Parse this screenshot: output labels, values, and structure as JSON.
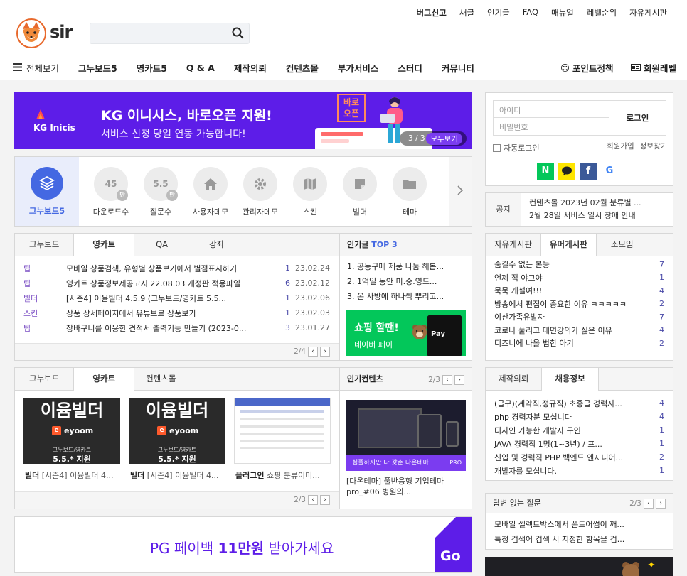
{
  "header": {
    "logo_text": "sir",
    "search_placeholder": "",
    "util_links": [
      "버그신고",
      "새글",
      "인기글",
      "FAQ",
      "매뉴얼",
      "레벨순위",
      "자유게시판"
    ],
    "gnb_all": "전체보기",
    "gnb_items": [
      "그누보드5",
      "영카트5",
      "Q & A",
      "제작의뢰",
      "컨텐츠몰",
      "부가서비스",
      "스터디",
      "커뮤니티"
    ],
    "point_policy": "포인트정책",
    "member_level": "회원레벨"
  },
  "banner": {
    "brand": "KG Inicis",
    "headline": "KG 이니시스, 바로오픈 지원!",
    "subline": "서비스 신청 당일 연동 가능합니다!",
    "badge": "바로\n오픈",
    "badge_line1": "바로",
    "badge_line2": "오픈",
    "pager": "3 / 3",
    "view_all": "모두보기"
  },
  "quick": {
    "title": "그누보드5",
    "items": [
      {
        "label": "다운로드수",
        "value": "45",
        "badge": "만"
      },
      {
        "label": "질문수",
        "value": "5.5",
        "badge": "만"
      },
      {
        "label": "사용자데모",
        "icon": "home-icon"
      },
      {
        "label": "관리자데모",
        "icon": "gear-icon"
      },
      {
        "label": "스킨",
        "icon": "map-icon"
      },
      {
        "label": "빌더",
        "icon": "note-icon"
      },
      {
        "label": "테마",
        "icon": "folder-icon"
      }
    ]
  },
  "board": {
    "tabs": [
      "그누보드",
      "영카트",
      "QA",
      "강좌"
    ],
    "active_tab": 1,
    "rows": [
      {
        "cat": "팁",
        "title": "모바일 상품검색, 유형별 상품보기에서 별점표시하기",
        "count": "1",
        "date": "23.02.24"
      },
      {
        "cat": "팁",
        "title": "영카트 상품정보제공고시 22.08.03 개정판 적용파일",
        "count": "6",
        "date": "23.02.12"
      },
      {
        "cat": "빌더",
        "title": "[시즌4] 이윰빌더 4.5.9 (그누보드/영카트 5.5...",
        "count": "1",
        "date": "23.02.06"
      },
      {
        "cat": "스킨",
        "title": "상품 상세페이지에서 유튜브로 상품보기",
        "count": "1",
        "date": "23.02.03"
      },
      {
        "cat": "팁",
        "title": "장바구니를 이용한 견적서 출력기능 만들기 (2023-0...",
        "count": "3",
        "date": "23.01.27"
      }
    ],
    "pager": "2/4"
  },
  "popular": {
    "title": "인기글",
    "title_accent": "TOP 3",
    "items": [
      "1. 공동구매 제품 나눔 해봅...",
      "2. 1억일 동안 미.중.영드...",
      "3. 온 사방에 하나씩 뿌리고..."
    ],
    "ad_line1": "쇼핑 할땐!",
    "ad_line2": "네이버 페이",
    "ad_pay": "Pay"
  },
  "gallery": {
    "tabs": [
      "그누보드",
      "영카트",
      "컨텐츠몰"
    ],
    "active_tab": 1,
    "items": [
      {
        "thumb_title": "이윰빌더",
        "thumb_brand": "eyoom",
        "thumb_sub": "그누보드/영카트",
        "thumb_ver": "5.5.* 지원",
        "cat": "빌더",
        "title": "[시즌4] 이윰빌더 4..."
      },
      {
        "thumb_title": "이윰빌더",
        "thumb_brand": "eyoom",
        "thumb_sub": "그누보드/영카트",
        "thumb_ver": "5.5.* 지원",
        "cat": "빌더",
        "title": "[시즌4] 이윰빌더 4..."
      },
      {
        "cat": "플러그인",
        "title": "쇼핑 분류이미..."
      }
    ],
    "pager": "2/3"
  },
  "popular_content": {
    "title": "인기컨텐츠",
    "pager": "2/3",
    "thumb_caption": "심플하지만 다 갖춘 다온테마",
    "thumb_badge": "PRO",
    "line1": "[다온테마] 풀반응형 기업테마",
    "line2": "pro_#06 병원의..."
  },
  "promo": {
    "text_pre": "PG 페이백 ",
    "text_bold": "11만원",
    "text_post": " 받아가세요",
    "go": "Go"
  },
  "login": {
    "id_placeholder": "아이디",
    "pw_placeholder": "비밀번호",
    "login_button": "로그인",
    "auto_login": "자동로그인",
    "join": "회원가입",
    "find": "정보찾기"
  },
  "notice": {
    "label": "공지",
    "lines": [
      "컨텐츠몰 2023년 02월 분류별 ...",
      "2월 28일 서비스 일시 장애 안내"
    ]
  },
  "community": {
    "tabs": [
      "자유게시판",
      "유머게시판",
      "소모임"
    ],
    "active_tab": 1,
    "rows": [
      {
        "title": "숨길수 없는 본능",
        "count": "7"
      },
      {
        "title": "언제 적 야그야",
        "count": "1"
      },
      {
        "title": "묵묵 개설여!!!",
        "count": "4"
      },
      {
        "title": "방송에서 편집이 중요한 이유 ㅋㅋㅋㅋㅋ",
        "count": "2"
      },
      {
        "title": "이산가족유발자",
        "count": "7"
      },
      {
        "title": "코로나 풀리고 대면강의가 싫은 이유",
        "count": "4"
      },
      {
        "title": "디즈니에 나올 법한 아기",
        "count": "2"
      }
    ]
  },
  "jobs": {
    "tabs": [
      "제작의뢰",
      "채용정보"
    ],
    "active_tab": 1,
    "rows": [
      {
        "title": "(급구)(계약직,정규직) 초중급 경력자...",
        "count": "4"
      },
      {
        "title": "php 경력자분 모십니다",
        "count": "4"
      },
      {
        "title": "디자인 가능한 개발자 구인",
        "count": "1"
      },
      {
        "title": "JAVA 경력직 1명(1~3년) / 프...",
        "count": "1"
      },
      {
        "title": "신입 및 경력직 PHP 백엔드 엔지니어...",
        "count": "2"
      },
      {
        "title": "개발자를 모십니다.",
        "count": "1"
      }
    ]
  },
  "unanswered": {
    "title": "답변 없는 질문",
    "pager": "2/3",
    "rows": [
      "모바일 셀렉트박스에서 폰트어썸이 깨...",
      "특정 검색어 검색 시 지정한 항목을 검..."
    ]
  },
  "colors": {
    "brand_purple": "#5d1de8",
    "accent_blue": "#4468e2",
    "naver_green": "#03c75a"
  }
}
